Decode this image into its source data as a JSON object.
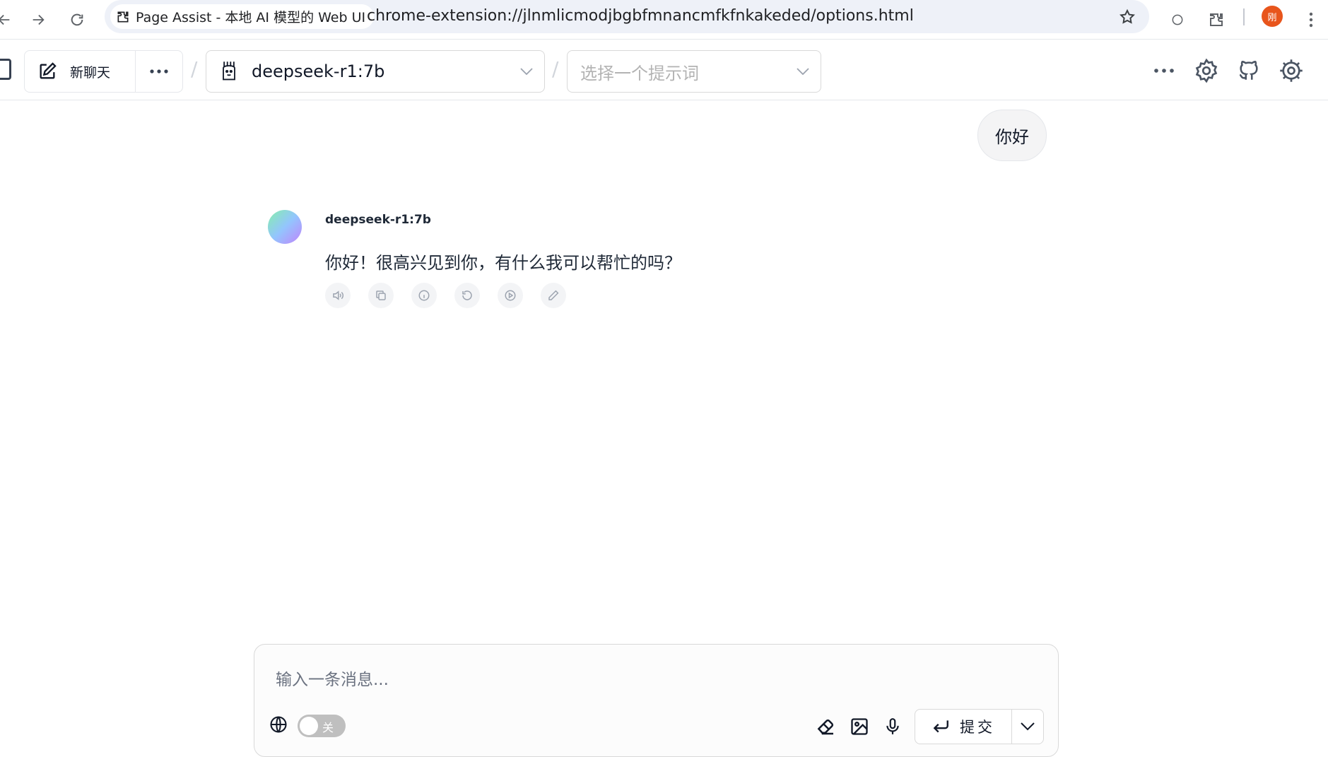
{
  "browser": {
    "tab_title": "Page Assist - 本地 AI 模型的 Web UI",
    "url": "chrome-extension://jlnmlicmodjbgbfmnancmfkfnkakeded/options.html",
    "profile_initial": "刚"
  },
  "header": {
    "new_chat_label": "新聊天",
    "model_selected": "deepseek-r1:7b",
    "prompt_placeholder": "选择一个提示词"
  },
  "messages": {
    "user_text": "你好",
    "bot_name": "deepseek-r1:7b",
    "bot_text": "你好！很高兴见到你，有什么我可以帮忙的吗？"
  },
  "composer": {
    "placeholder": "输入一条消息...",
    "web_search_state": "关",
    "submit_label": "提交"
  },
  "colors": {
    "accent_avatar_from": "#86efac",
    "accent_avatar_to": "#c084fc",
    "profile_bg": "#e8551c",
    "toggle_off": "#bfbfbf"
  }
}
